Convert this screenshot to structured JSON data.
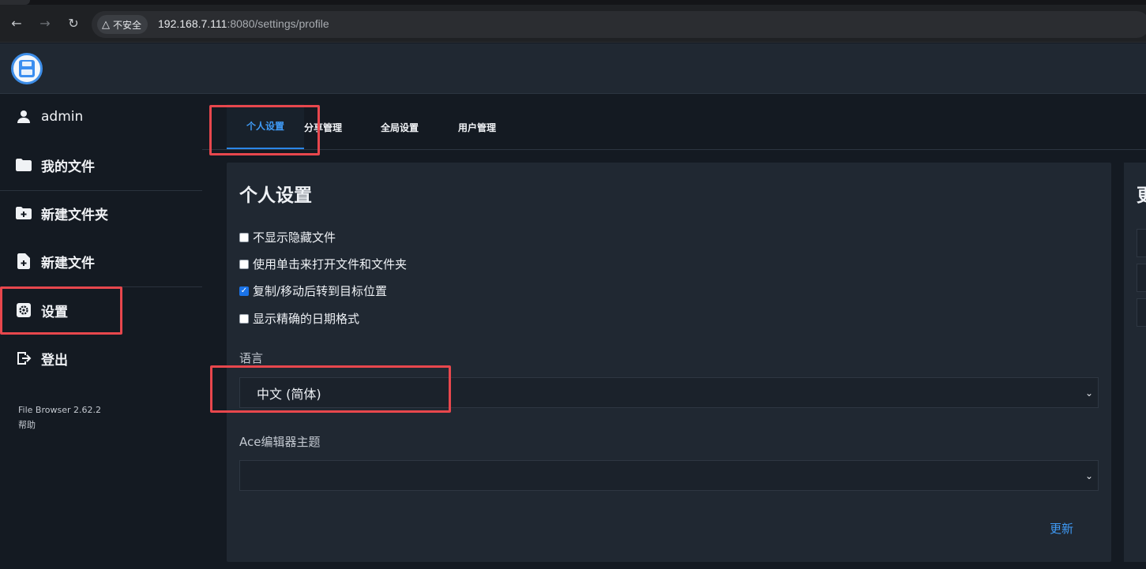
{
  "browser": {
    "security_label": "不安全",
    "url_host": "192.168.7.111",
    "url_rest": ":8080/settings/profile"
  },
  "sidebar": {
    "user": "admin",
    "items": [
      {
        "label": "我的文件",
        "icon": "folder-icon"
      },
      {
        "label": "新建文件夹",
        "icon": "new-folder-icon"
      },
      {
        "label": "新建文件",
        "icon": "new-file-icon"
      },
      {
        "label": "设置",
        "icon": "settings-icon"
      },
      {
        "label": "登出",
        "icon": "logout-icon"
      }
    ],
    "version": "File Browser 2.62.2",
    "help": "帮助"
  },
  "tabs": [
    {
      "label": "个人设置",
      "active": true
    },
    {
      "label": "分享管理",
      "active": false
    },
    {
      "label": "全局设置",
      "active": false
    },
    {
      "label": "用户管理",
      "active": false
    }
  ],
  "profile": {
    "title": "个人设置",
    "checkboxes": [
      {
        "label": "不显示隐藏文件",
        "checked": false
      },
      {
        "label": "使用单击来打开文件和文件夹",
        "checked": false
      },
      {
        "label": "复制/移动后转到目标位置",
        "checked": true
      },
      {
        "label": "显示精确的日期格式",
        "checked": false
      }
    ],
    "language_label": "语言",
    "language_value": "中文 (简体)",
    "ace_label": "Ace编辑器主题",
    "ace_value": "",
    "update_label": "更新"
  },
  "password_card": {
    "title_partial": "更"
  },
  "colors": {
    "accent": "#3f9af5",
    "highlight": "#e8474d",
    "background": "#141a22",
    "card": "#202832"
  }
}
